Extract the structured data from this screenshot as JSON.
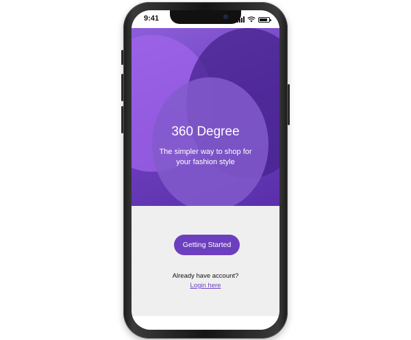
{
  "status_bar": {
    "time": "9:41"
  },
  "hero": {
    "title": "360 Degree",
    "subtitle": "The simpler way to shop for your fashion style"
  },
  "actions": {
    "primary_button_label": "Getting Started",
    "account_prompt": "Already have account?",
    "login_link_label": "Login here"
  },
  "colors": {
    "accent": "#6c3fbf",
    "hero_purple": "#7a4fc8",
    "screen_background": "#efefef"
  },
  "icons": [
    "signal-icon",
    "wifi-icon",
    "battery-icon"
  ]
}
